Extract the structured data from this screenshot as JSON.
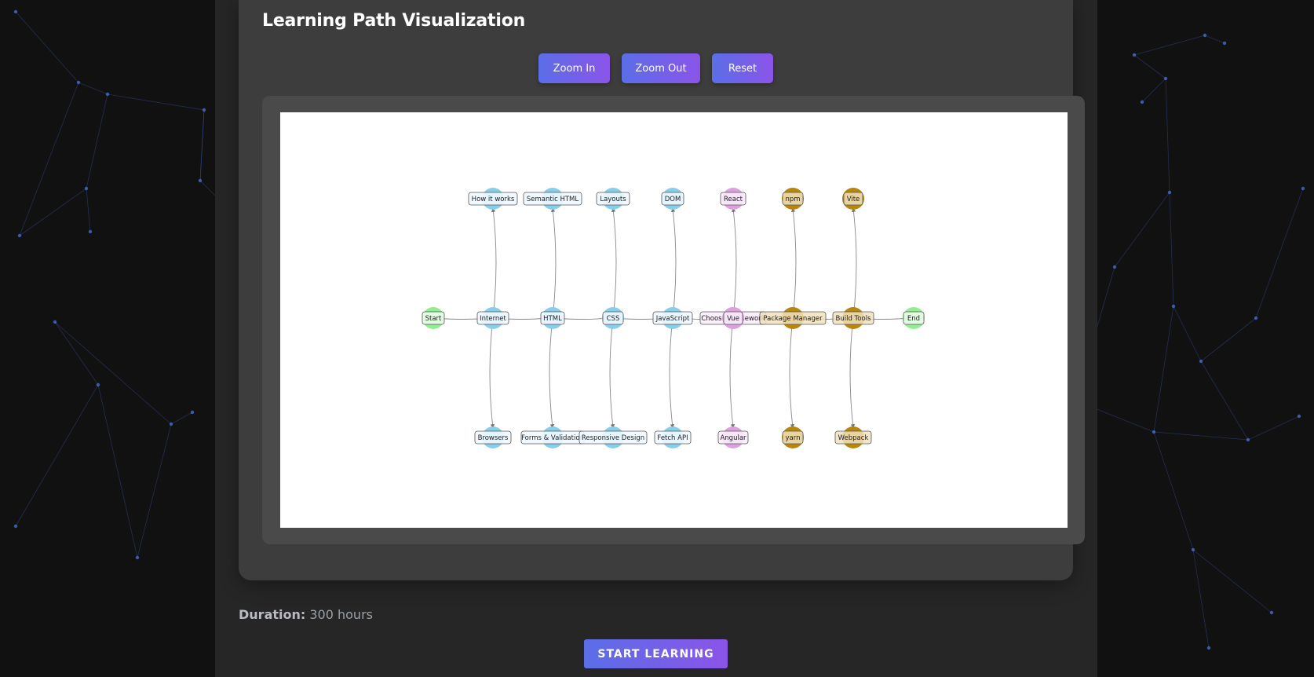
{
  "page": {
    "title": "Learning Path Visualization"
  },
  "controls": {
    "zoom_in": "Zoom In",
    "zoom_out": "Zoom Out",
    "reset": "Reset"
  },
  "graph": {
    "colors": {
      "endpoint": "#90ee90",
      "fundamentals": "#87ceeb",
      "frameworks": "#dda0dd",
      "tooling": "#b8860b",
      "edge": "#888888"
    },
    "nodes": [
      {
        "id": "start",
        "label": "Start",
        "group": "endpoint"
      },
      {
        "id": "internet",
        "label": "Internet",
        "group": "fundamentals"
      },
      {
        "id": "how-it-works",
        "label": "How it works",
        "group": "fundamentals"
      },
      {
        "id": "browsers",
        "label": "Browsers",
        "group": "fundamentals"
      },
      {
        "id": "html",
        "label": "HTML",
        "group": "fundamentals"
      },
      {
        "id": "semantic-html",
        "label": "Semantic HTML",
        "group": "fundamentals"
      },
      {
        "id": "forms",
        "label": "Forms & Validation",
        "group": "fundamentals"
      },
      {
        "id": "css",
        "label": "CSS",
        "group": "fundamentals"
      },
      {
        "id": "layouts",
        "label": "Layouts",
        "group": "fundamentals"
      },
      {
        "id": "responsive",
        "label": "Responsive Design",
        "group": "fundamentals"
      },
      {
        "id": "javascript",
        "label": "JavaScript",
        "group": "fundamentals"
      },
      {
        "id": "dom",
        "label": "DOM",
        "group": "fundamentals"
      },
      {
        "id": "fetch-api",
        "label": "Fetch API",
        "group": "fundamentals"
      },
      {
        "id": "choose-framework",
        "label": "Choose Framework",
        "group": "frameworks"
      },
      {
        "id": "react",
        "label": "React",
        "group": "frameworks"
      },
      {
        "id": "vue",
        "label": "Vue",
        "group": "frameworks"
      },
      {
        "id": "angular",
        "label": "Angular",
        "group": "frameworks"
      },
      {
        "id": "package-manager",
        "label": "Package Manager",
        "group": "tooling"
      },
      {
        "id": "npm",
        "label": "npm",
        "group": "tooling"
      },
      {
        "id": "yarn",
        "label": "yarn",
        "group": "tooling"
      },
      {
        "id": "build-tools",
        "label": "Build Tools",
        "group": "tooling"
      },
      {
        "id": "vite",
        "label": "Vite",
        "group": "tooling"
      },
      {
        "id": "webpack",
        "label": "Webpack",
        "group": "tooling"
      },
      {
        "id": "end",
        "label": "End",
        "group": "endpoint"
      }
    ],
    "edges": [
      [
        "start",
        "internet"
      ],
      [
        "internet",
        "how-it-works"
      ],
      [
        "internet",
        "browsers"
      ],
      [
        "internet",
        "html"
      ],
      [
        "html",
        "semantic-html"
      ],
      [
        "html",
        "forms"
      ],
      [
        "html",
        "css"
      ],
      [
        "css",
        "layouts"
      ],
      [
        "css",
        "responsive"
      ],
      [
        "css",
        "javascript"
      ],
      [
        "javascript",
        "dom"
      ],
      [
        "javascript",
        "fetch-api"
      ],
      [
        "javascript",
        "choose-framework"
      ],
      [
        "choose-framework",
        "react"
      ],
      [
        "choose-framework",
        "vue"
      ],
      [
        "choose-framework",
        "angular"
      ],
      [
        "choose-framework",
        "package-manager"
      ],
      [
        "package-manager",
        "npm"
      ],
      [
        "package-manager",
        "yarn"
      ],
      [
        "package-manager",
        "build-tools"
      ],
      [
        "build-tools",
        "vite"
      ],
      [
        "build-tools",
        "webpack"
      ],
      [
        "build-tools",
        "end"
      ]
    ]
  },
  "duration": {
    "label": "Duration:",
    "value": "300 hours"
  },
  "cta": {
    "label": "START LEARNING"
  }
}
